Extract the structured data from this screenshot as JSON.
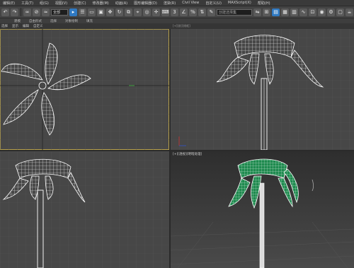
{
  "menu": [
    "编辑(E)",
    "工具(T)",
    "组(G)",
    "视图(V)",
    "创建(C)",
    "修改器(M)",
    "动画(A)",
    "图形编辑器(D)",
    "渲染(R)",
    "Civil View",
    "自定义(U)",
    "MAXScript(X)",
    "帮助(H)"
  ],
  "toolbar": {
    "select_filter": "全部",
    "named_selection": "创建选择集"
  },
  "ribbon": [
    "建模",
    "自由形式",
    "选择",
    "对象绘制",
    "填充"
  ],
  "subbar": [
    "选择",
    "显示",
    "编辑",
    "自定义"
  ],
  "viewports": {
    "top_left": "",
    "top_right": "[+][前][线框]",
    "bottom_left": "",
    "bottom_right": "[+][透视][明暗处理]"
  }
}
